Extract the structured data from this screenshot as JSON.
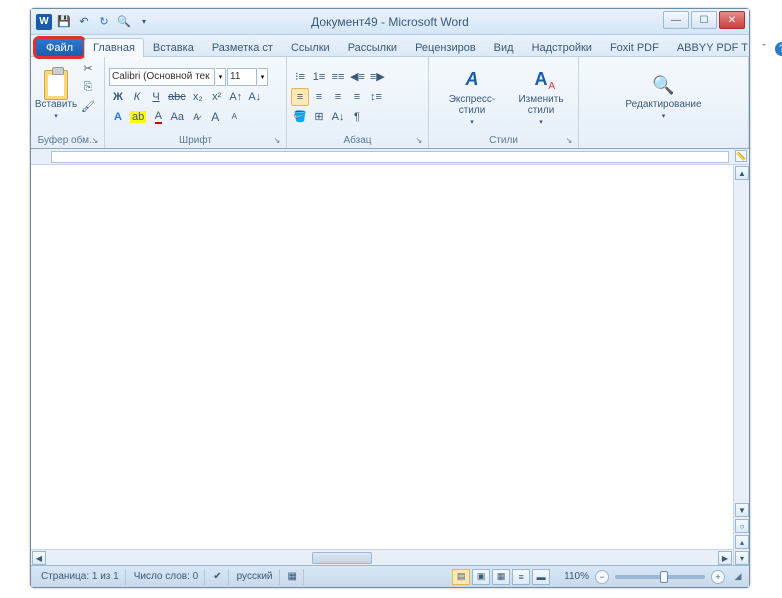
{
  "title": "Документ49  -  Microsoft Word",
  "tabs": {
    "file": "Файл",
    "home": "Главная",
    "insert": "Вставка",
    "layout": "Разметка ст",
    "refs": "Ссылки",
    "mail": "Рассылки",
    "review": "Рецензиров",
    "view": "Вид",
    "addins": "Надстройки",
    "foxit": "Foxit PDF",
    "abbyy": "ABBYY PDF T"
  },
  "ribbon": {
    "clipboard": {
      "paste": "Вставить",
      "group": "Буфер обм..."
    },
    "font": {
      "name": "Calibri (Основной тек",
      "size": "11",
      "group": "Шрифт"
    },
    "paragraph": {
      "group": "Абзац"
    },
    "styles": {
      "quick": "Экспресс-стили",
      "change": "Изменить стили",
      "group": "Стили"
    },
    "editing": {
      "label": "Редактирование"
    }
  },
  "status": {
    "page": "Страница: 1 из 1",
    "words": "Число слов: 0",
    "lang": "русский",
    "zoom": "110%"
  }
}
